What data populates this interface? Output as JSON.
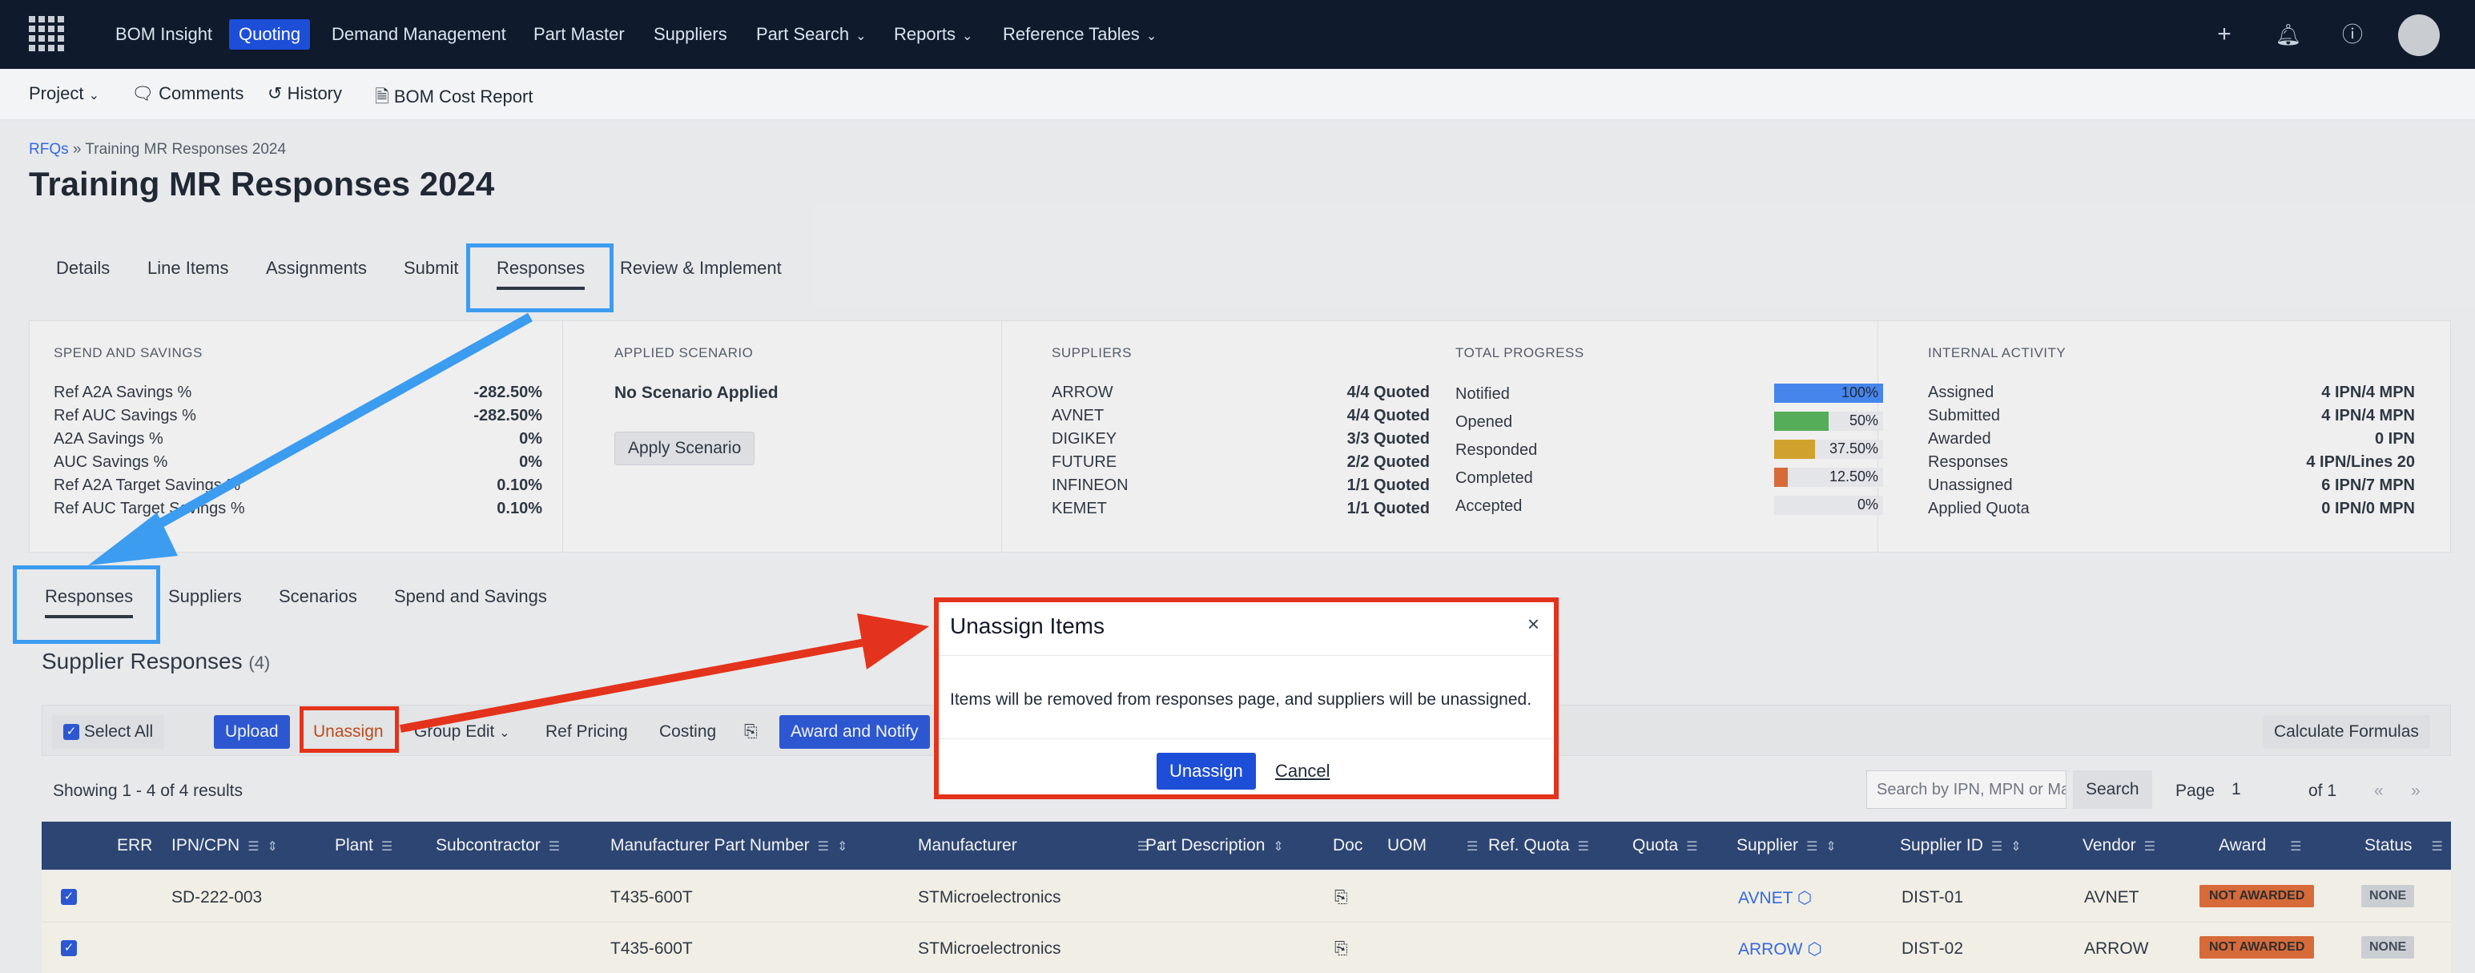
{
  "nav": {
    "items": [
      "BOM Insight",
      "Quoting",
      "Demand Management",
      "Part Master",
      "Suppliers",
      "Part Search",
      "Reports",
      "Reference Tables"
    ],
    "active": "Quoting"
  },
  "subbar": {
    "project": "Project",
    "comments": "Comments",
    "history": "History",
    "bom_cost_report": "BOM Cost Report"
  },
  "breadcrumb": {
    "root": "RFQs",
    "sep": "»",
    "current": "Training MR Responses 2024"
  },
  "page_title": "Training MR Responses 2024",
  "tabs": [
    "Details",
    "Line Items",
    "Assignments",
    "Submit",
    "Responses",
    "Review & Implement"
  ],
  "spend": {
    "title": "SPEND AND SAVINGS",
    "rows": [
      {
        "label": "Ref A2A Savings %",
        "value": "-282.50%"
      },
      {
        "label": "Ref AUC Savings %",
        "value": "-282.50%"
      },
      {
        "label": "A2A Savings %",
        "value": "0%"
      },
      {
        "label": "AUC Savings %",
        "value": "0%"
      },
      {
        "label": "Ref A2A Target Savings %",
        "value": "0.10%"
      },
      {
        "label": "Ref AUC Target Savings %",
        "value": "0.10%"
      }
    ]
  },
  "scenario": {
    "title": "APPLIED SCENARIO",
    "value": "No Scenario Applied",
    "button": "Apply Scenario"
  },
  "suppliers": {
    "title": "SUPPLIERS",
    "rows": [
      {
        "label": "ARROW",
        "value": "4/4 Quoted"
      },
      {
        "label": "AVNET",
        "value": "4/4 Quoted"
      },
      {
        "label": "DIGIKEY",
        "value": "3/3 Quoted"
      },
      {
        "label": "FUTURE",
        "value": "2/2 Quoted"
      },
      {
        "label": "INFINEON",
        "value": "1/1 Quoted"
      },
      {
        "label": "KEMET",
        "value": "1/1 Quoted"
      }
    ]
  },
  "progress": {
    "title": "TOTAL PROGRESS",
    "rows": [
      {
        "label": "Notified",
        "pct": "100%",
        "fraction": 1.0,
        "color": "#3b82f6"
      },
      {
        "label": "Opened",
        "pct": "50%",
        "fraction": 0.5,
        "color": "#4caf50"
      },
      {
        "label": "Responded",
        "pct": "37.50%",
        "fraction": 0.375,
        "color": "#d8a21e"
      },
      {
        "label": "Completed",
        "pct": "12.50%",
        "fraction": 0.125,
        "color": "#e0642c"
      },
      {
        "label": "Accepted",
        "pct": "0%",
        "fraction": 0.0,
        "color": "#e48cbf"
      }
    ]
  },
  "internal": {
    "title": "INTERNAL ACTIVITY",
    "rows": [
      {
        "label": "Assigned",
        "value": "4 IPN/4 MPN"
      },
      {
        "label": "Submitted",
        "value": "4 IPN/4 MPN"
      },
      {
        "label": "Awarded",
        "value": "0 IPN"
      },
      {
        "label": "Responses",
        "value": "4 IPN/Lines 20"
      },
      {
        "label": "Unassigned",
        "value": "6 IPN/7 MPN"
      },
      {
        "label": "Applied Quota",
        "value": "0 IPN/0 MPN"
      }
    ]
  },
  "subtabs": [
    "Responses",
    "Suppliers",
    "Scenarios",
    "Spend and Savings"
  ],
  "section": {
    "title": "Supplier Responses",
    "count": "(4)"
  },
  "toolbar": {
    "select_all": "Select All",
    "upload": "Upload",
    "unassign": "Unassign",
    "group_edit": "Group Edit",
    "ref_pricing": "Ref Pricing",
    "costing": "Costing",
    "award_notify": "Award and Notify",
    "calc": "Calculate Formulas"
  },
  "results_text": "Showing 1 - 4 of 4 results",
  "search": {
    "placeholder": "Search by IPN, MPN or Ma",
    "button": "Search"
  },
  "pager": {
    "page_label": "Page",
    "page": "1",
    "of": "of 1",
    "prev": "«",
    "next": "»"
  },
  "table": {
    "columns": [
      "ERR",
      "IPN/CPN",
      "Plant",
      "Subcontractor",
      "Manufacturer Part Number",
      "Manufacturer",
      "Part Description",
      "Doc",
      "UOM",
      "Ref. Quota",
      "Quota",
      "Supplier",
      "Supplier ID",
      "Vendor",
      "Award",
      "Status"
    ],
    "rows": [
      {
        "ipn": "SD-222-003",
        "mpn": "T435-600T",
        "manufacturer": "STMicroelectronics",
        "supplier": "AVNET",
        "supplier_id": "DIST-01",
        "vendor": "AVNET",
        "award": "NOT AWARDED",
        "status": "NONE"
      },
      {
        "ipn": "",
        "mpn": "T435-600T",
        "manufacturer": "STMicroelectronics",
        "supplier": "ARROW",
        "supplier_id": "DIST-02",
        "vendor": "ARROW",
        "award": "NOT AWARDED",
        "status": "NONE"
      }
    ]
  },
  "modal": {
    "title": "Unassign Items",
    "body": "Items will be removed from responses page, and suppliers will be unassigned.",
    "confirm": "Unassign",
    "cancel": "Cancel",
    "close": "×"
  }
}
